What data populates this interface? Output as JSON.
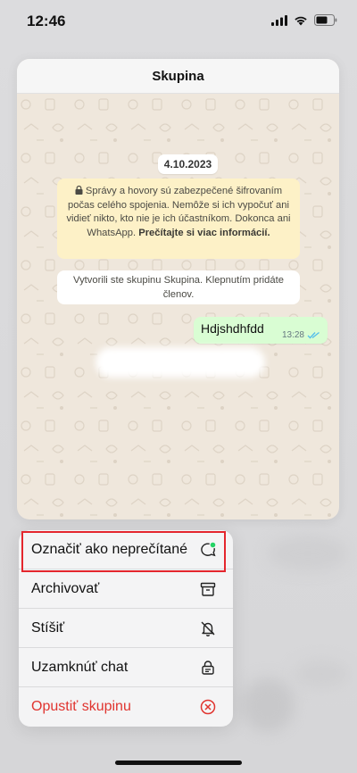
{
  "status_bar": {
    "time": "12:46"
  },
  "preview": {
    "title": "Skupina",
    "date": "4.10.2023",
    "encryption_notice": "Správy a hovory sú zabezpečené šifrovaním počas celého spojenia. Nemôže si ich vypočuť ani vidieť nikto, kto nie je ich účastníkom. Dokonca ani WhatsApp.",
    "encryption_link": "Prečítajte si viac informácií.",
    "created_notice": "Vytvorili ste skupinu Skupina. Klepnutím pridáte členov.",
    "message": {
      "text": "Hdjshdhfdd",
      "time": "13:28",
      "status_icon": "double-check-icon"
    }
  },
  "menu": {
    "items": [
      {
        "label": "Označiť ako neprečítané",
        "icon": "unread-chat-icon"
      },
      {
        "label": "Archivovať",
        "icon": "archive-box-icon"
      },
      {
        "label": "Stíšiť",
        "icon": "bell-slash-icon"
      },
      {
        "label": "Uzamknúť chat",
        "icon": "lock-chat-icon"
      },
      {
        "label": "Opustiť skupinu",
        "icon": "leave-circle-icon"
      }
    ]
  },
  "colors": {
    "highlight": "#e4262d",
    "danger": "#e0342f",
    "whatsapp_green": "#25d366",
    "outgoing_bubble": "#d9fdd3",
    "notice_bubble": "#fdf1c7",
    "read_ticks": "#53bdeb"
  }
}
